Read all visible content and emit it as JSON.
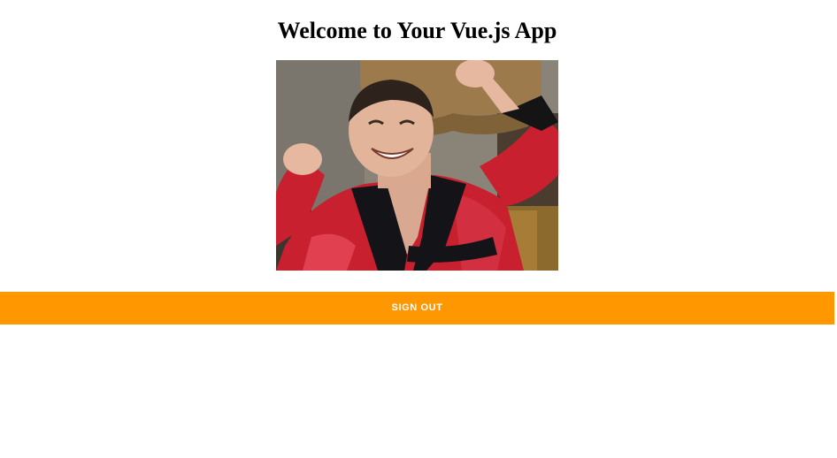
{
  "page": {
    "title": "Welcome to Your Vue.js App"
  },
  "hero_image": {
    "description_icon": "celebrating-man-gif"
  },
  "actions": {
    "sign_out_label": "SIGN OUT"
  },
  "colors": {
    "accent": "#ff9800",
    "button_text": "#ffffff",
    "background": "#ffffff",
    "title_text": "#000000"
  }
}
